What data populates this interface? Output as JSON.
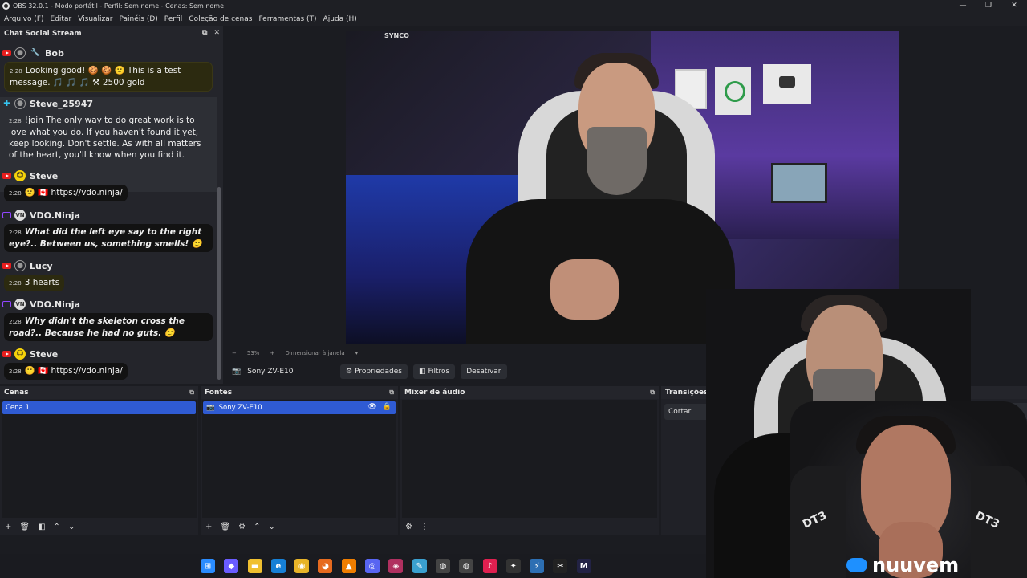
{
  "window": {
    "title": "OBS 32.0.1 - Modo portátil - Perfil: Sem nome - Cenas: Sem nome",
    "controls": [
      "—",
      "❐",
      "✕"
    ]
  },
  "menu": [
    "Arquivo (F)",
    "Editar",
    "Visualizar",
    "Painéis (D)",
    "Perfil",
    "Coleção de cenas",
    "Ferramentas (T)",
    "Ajuda (H)"
  ],
  "chat": {
    "title": "Chat Social Stream",
    "messages": [
      {
        "user": "Bob",
        "time": "2:28",
        "text": "Looking good! 🍪 🍪 🙂 This is a test message. 🎵 🎵 🎵 ⚒ 2500 gold"
      },
      {
        "user": "Steve_25947",
        "time": "2:28",
        "text": "!join The only way to do great work is to love what you do. If you haven't found it yet, keep looking. Don't settle. As with all matters of the heart, you'll know when you find it."
      },
      {
        "user": "Steve",
        "time": "2:28",
        "text": "🙂 🇨🇦 https://vdo.ninja/"
      },
      {
        "user": "VDO.Ninja",
        "time": "2:28",
        "text": "What did the left eye say to the right eye?.. Between us, something smells! 🙂"
      },
      {
        "user": "Lucy",
        "time": "2:28",
        "text": "3 hearts"
      },
      {
        "user": "VDO.Ninja",
        "time": "2:28",
        "text": "Why didn't the skeleton cross the road?.. Because he had no guts. 🙂"
      },
      {
        "user": "Steve",
        "time": "2:28",
        "text": "🙂 🇨🇦 https://vdo.ninja/"
      }
    ]
  },
  "preview": {
    "camera_brand": "SYNCO",
    "zoom": "53%",
    "scale_mode": "Dimensionar à janela"
  },
  "source_toolbar": {
    "source_name": "Sony ZV-E10",
    "properties": "Propriedades",
    "filters": "Filtros",
    "deactivate": "Desativar"
  },
  "docks": {
    "scenes": {
      "title": "Cenas",
      "items": [
        "Cena 1"
      ]
    },
    "sources": {
      "title": "Fontes",
      "items": [
        "Sony ZV-E10"
      ]
    },
    "mixer": {
      "title": "Mixer de áudio"
    },
    "transitions": {
      "title": "Transições de cena",
      "current": "Cortar"
    }
  },
  "overlay": {
    "brand": "nuuvem",
    "dt_badge": "DT3"
  }
}
